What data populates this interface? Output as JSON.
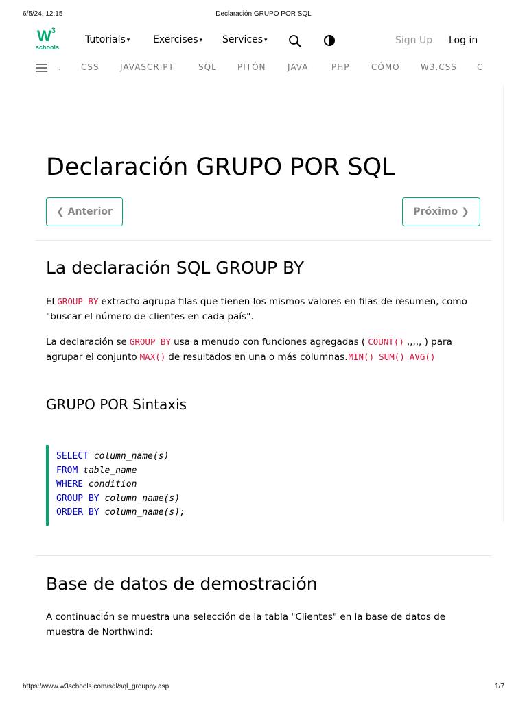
{
  "print": {
    "datetime": "6/5/24, 12:15",
    "doc_title": "Declaración GRUPO POR SQL",
    "url": "https://www.w3schools.com/sql/sql_groupby.asp",
    "page_num": "1/7"
  },
  "logo": {
    "w3": "W",
    "sup": "3",
    "sub": "schools",
    "color": "#04AA6D"
  },
  "topnav": {
    "tutorials": "Tutorials",
    "exercises": "Exercises",
    "services": "Services",
    "caret": "▾",
    "search_icon": "search-icon",
    "contrast_icon": "contrast-icon",
    "signup": "Sign Up",
    "login": "Log in"
  },
  "subnav": {
    "dot": ".",
    "items": [
      "CSS",
      "JAVASCRIPT",
      "SQL",
      "PITÓN",
      "JAVA",
      "PHP",
      "CÓMO",
      "W3.CSS",
      "C"
    ]
  },
  "main": {
    "title": "Declaración GRUPO POR SQL",
    "prev": "❮ Anterior",
    "next": "Próximo ❯",
    "section1_heading": "La declaración SQL GROUP BY",
    "p1": {
      "a": "El",
      "code": "GROUP BY",
      "b": "extracto agrupa filas que tienen los mismos valores en filas de resumen, como \"buscar el número de clientes en cada país\"."
    },
    "p2": {
      "a": "La declaración se",
      "code1": "GROUP BY",
      "b": "usa a menudo con funciones agregadas (",
      "code2": "COUNT()",
      "c": ",,,,, ) para agrupar el conjunto",
      "code3": "MAX()",
      "d": "de resultados en una o más columnas.",
      "code4": "MIN()",
      "code5": "SUM()",
      "code6": "AVG()"
    },
    "syntax_heading": "GRUPO POR Sintaxis",
    "syntax": [
      {
        "kw": "SELECT",
        "arg": "column_name(s)"
      },
      {
        "kw": "FROM",
        "arg": "table_name"
      },
      {
        "kw": "WHERE",
        "arg": "condition"
      },
      {
        "kw": "GROUP BY",
        "arg": "column_name(s)"
      },
      {
        "kw": "ORDER BY",
        "arg": "column_name(s);"
      }
    ],
    "section2_heading": "Base de datos de demostración",
    "p3": "A continuación se muestra una selección de la tabla \"Clientes\" en la base de datos de muestra de Northwind:"
  }
}
